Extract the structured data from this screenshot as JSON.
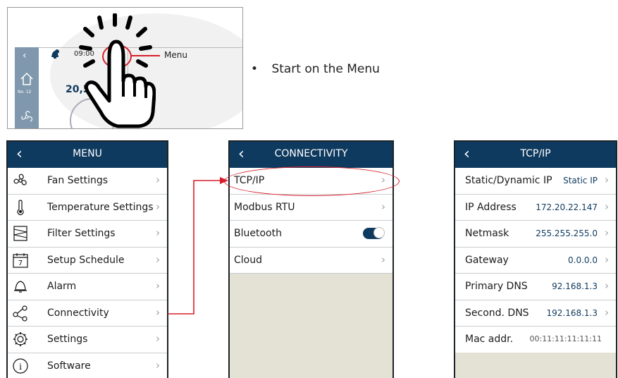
{
  "snapshot": {
    "time": "09:00",
    "temp": "20,5",
    "no_label": "No. 12",
    "callout_label": "Menu"
  },
  "instruction": {
    "bullet": "•",
    "text": "Start on the Menu"
  },
  "menu_screen": {
    "title": "MENU",
    "items": [
      {
        "label": "Fan Settings",
        "icon": "fan-icon"
      },
      {
        "label": "Temperature Settings",
        "icon": "thermometer-icon"
      },
      {
        "label": "Filter Settings",
        "icon": "filter-icon"
      },
      {
        "label": "Setup Schedule",
        "icon": "calendar-icon",
        "day": "7"
      },
      {
        "label": "Alarm",
        "icon": "bell-icon"
      },
      {
        "label": "Connectivity",
        "icon": "share-icon"
      },
      {
        "label": "Settings",
        "icon": "gear-icon"
      },
      {
        "label": "Software",
        "icon": "info-icon",
        "glyph": "i"
      }
    ]
  },
  "connectivity_screen": {
    "title": "CONNECTIVITY",
    "items": [
      {
        "label": "TCP/IP"
      },
      {
        "label": "Modbus RTU"
      },
      {
        "label": "Bluetooth",
        "toggle": "on"
      },
      {
        "label": "Cloud"
      }
    ]
  },
  "tcpip_screen": {
    "title": "TCP/IP",
    "items": [
      {
        "label": "Static/Dynamic IP",
        "value": "Static IP"
      },
      {
        "label": "IP Address",
        "value": "172.20.22.147"
      },
      {
        "label": "Netmask",
        "value": "255.255.255.0"
      },
      {
        "label": "Gateway",
        "value": "0.0.0.0"
      },
      {
        "label": "Primary DNS",
        "value": "92.168.1.3"
      },
      {
        "label": "Second. DNS",
        "value": "192.168.1.3"
      },
      {
        "label": "Mac addr.",
        "value": "00:11:11:11:11:11"
      }
    ]
  },
  "colors": {
    "header": "#0f3a5f",
    "callout": "#d81e2a",
    "filler": "#e3e2d5"
  }
}
